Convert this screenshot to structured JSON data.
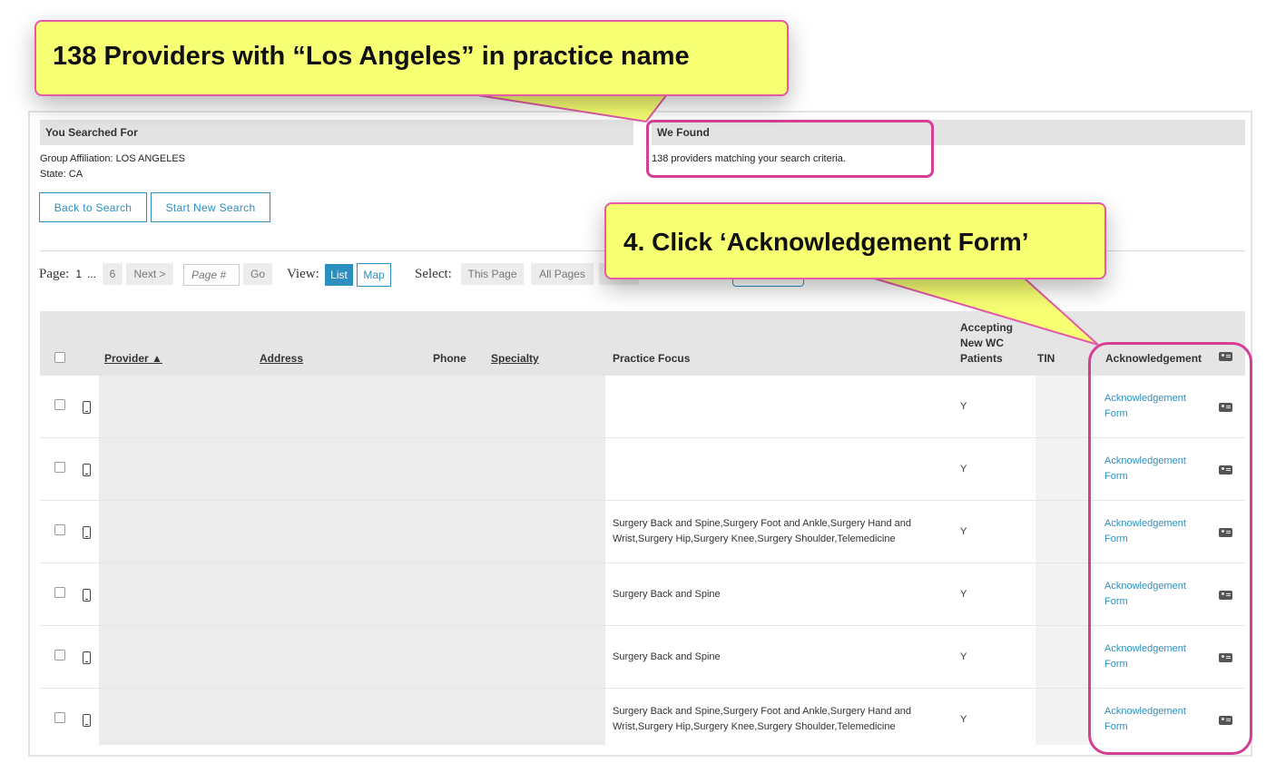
{
  "callouts": {
    "top": "138 Providers with “Los Angeles” in practice name",
    "step": "4. Click ‘Acknowledgement Form’"
  },
  "search_summary": {
    "searched_for_title": "You Searched For",
    "found_title": "We Found",
    "criteria": [
      "Group Affiliation: LOS ANGELES",
      "State: CA"
    ],
    "found_text": "138 providers matching your search criteria."
  },
  "buttons": {
    "back": "Back to Search",
    "new_search": "Start New Search"
  },
  "pagination": {
    "page_label": "Page:",
    "current": "1",
    "ellipsis": "...",
    "last": "6",
    "next": "Next >",
    "page_input_placeholder": "Page #",
    "go": "Go",
    "view_label": "View:",
    "view_list": "List",
    "view_map": "Map",
    "select_label": "Select:",
    "this_page": "This Page",
    "all_pages": "All Pages"
  },
  "table": {
    "headers": {
      "provider": "Provider ▲",
      "address": "Address",
      "phone": "Phone",
      "specialty": "Specialty",
      "practice_focus": "Practice Focus",
      "accepting": [
        "Accepting",
        "New WC",
        "Patients"
      ],
      "tin": "TIN",
      "acknowledgement": "Acknowledgement"
    },
    "rows": [
      {
        "practice_focus": "",
        "accepting": "Y",
        "ack": "Acknowledgement Form"
      },
      {
        "practice_focus": "",
        "accepting": "Y",
        "ack": "Acknowledgement Form"
      },
      {
        "practice_focus": "Surgery Back and Spine,Surgery Foot and Ankle,Surgery Hand and Wrist,Surgery Hip,Surgery Knee,Surgery Shoulder,Telemedicine",
        "accepting": "Y",
        "ack": "Acknowledgement Form"
      },
      {
        "practice_focus": "Surgery Back and Spine",
        "accepting": "Y",
        "ack": "Acknowledgement Form"
      },
      {
        "practice_focus": "Surgery Back and Spine",
        "accepting": "Y",
        "ack": "Acknowledgement Form"
      },
      {
        "practice_focus": "Surgery Back and Spine,Surgery Foot and Ankle,Surgery Hand and Wrist,Surgery Hip,Surgery Knee,Surgery Shoulder,Telemedicine",
        "accepting": "Y",
        "ack": "Acknowledgement Form"
      }
    ]
  },
  "colors": {
    "accent": "#2d8fbf",
    "callout_fill": "#f7ff72",
    "highlight": "#d43f96"
  }
}
